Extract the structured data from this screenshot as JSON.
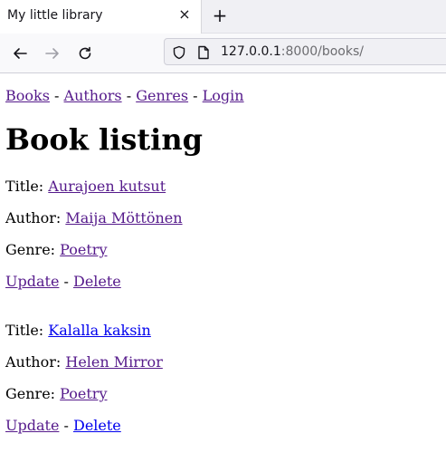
{
  "browser": {
    "tab_title": "My little library",
    "tab_close": "×",
    "new_tab": "+",
    "url_host": "127.0.0.1",
    "url_rest": ":8000/books/"
  },
  "nav": {
    "books": "Books",
    "authors": "Authors",
    "genres": "Genres",
    "login": "Login",
    "separator": " - "
  },
  "page_title": "Book listing",
  "labels": {
    "title": "Title: ",
    "author": "Author: ",
    "genre": "Genre: ",
    "update": "Update",
    "delete": "Delete",
    "sep": " - "
  },
  "books": [
    {
      "title": "Aurajoen kutsut",
      "author": "Maija Möttönen",
      "genre": "Poetry"
    },
    {
      "title": "Kalalla kaksin",
      "author": "Helen Mirror",
      "genre": "Poetry"
    }
  ]
}
